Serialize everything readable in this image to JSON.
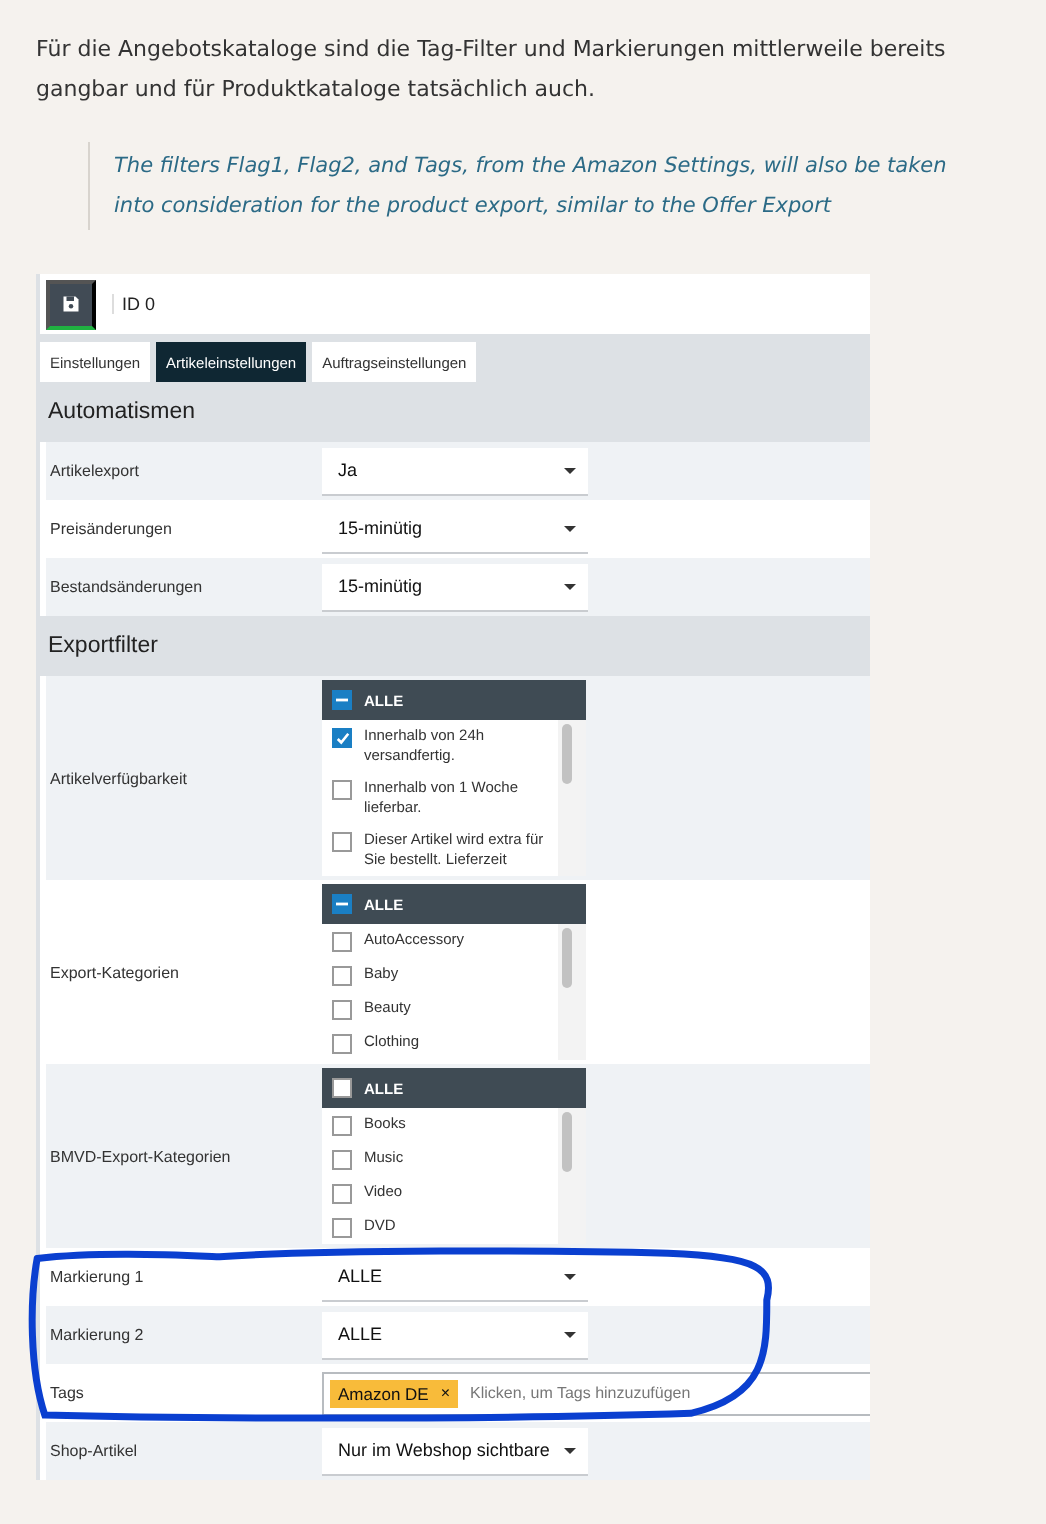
{
  "intro": "Für die Angebotskataloge sind die Tag-Filter und Markierungen mittlerweile bereits gangbar und für Produktkataloge tatsächlich auch.",
  "quote": "The filters Flag1, Flag2, and Tags, from the Amazon Settings, will also be taken into consideration for the product export, similar to the Offer Export",
  "toolbar": {
    "id_label": "ID 0"
  },
  "tabs": [
    {
      "label": "Einstellungen",
      "selected": false
    },
    {
      "label": "Artikeleinstellungen",
      "selected": true
    },
    {
      "label": "Auftragseinstellungen",
      "selected": false
    }
  ],
  "sections": [
    {
      "title": "Automatismen",
      "rows": [
        {
          "kind": "select",
          "label": "Artikelexport",
          "value": "Ja"
        },
        {
          "kind": "select",
          "label": "Preisänderungen",
          "value": "15-minütig"
        },
        {
          "kind": "select",
          "label": "Bestandsänderungen",
          "value": "15-minütig"
        }
      ]
    },
    {
      "title": "Exportfilter",
      "rows": [
        {
          "kind": "multiselect",
          "label": "Artikelverfügbarkeit",
          "all": {
            "label": "ALLE",
            "checked": false,
            "partial": true
          },
          "options": [
            {
              "label": "Innerhalb von 24h versandfertig.",
              "checked": true
            },
            {
              "label": "Innerhalb von 1 Woche lieferbar.",
              "checked": false
            },
            {
              "label": "Dieser Artikel wird extra für Sie bestellt. Lieferzeit",
              "checked": false
            }
          ]
        },
        {
          "kind": "multiselect",
          "label": "Export-Kategorien",
          "all": {
            "label": "ALLE",
            "checked": false,
            "partial": true
          },
          "options": [
            {
              "label": "AutoAccessory",
              "checked": false
            },
            {
              "label": "Baby",
              "checked": false
            },
            {
              "label": "Beauty",
              "checked": false
            },
            {
              "label": "Clothing",
              "checked": false
            }
          ]
        },
        {
          "kind": "multiselect",
          "label": "BMVD-Export-Kategorien",
          "all": {
            "label": "ALLE",
            "checked": false,
            "partial": false
          },
          "options": [
            {
              "label": "Books",
              "checked": false
            },
            {
              "label": "Music",
              "checked": false
            },
            {
              "label": "Video",
              "checked": false
            },
            {
              "label": "DVD",
              "checked": false
            }
          ]
        },
        {
          "kind": "select",
          "label": "Markierung 1",
          "value": "ALLE"
        },
        {
          "kind": "select",
          "label": "Markierung 2",
          "value": "ALLE"
        },
        {
          "kind": "tags",
          "label": "Tags",
          "tags": [
            {
              "label": "Amazon DE",
              "remove": "×"
            }
          ],
          "placeholder": "Klicken, um Tags hinzuzufügen"
        },
        {
          "kind": "select",
          "label": "Shop-Artikel",
          "value": "Nur im Webshop sichtbare"
        }
      ]
    }
  ]
}
